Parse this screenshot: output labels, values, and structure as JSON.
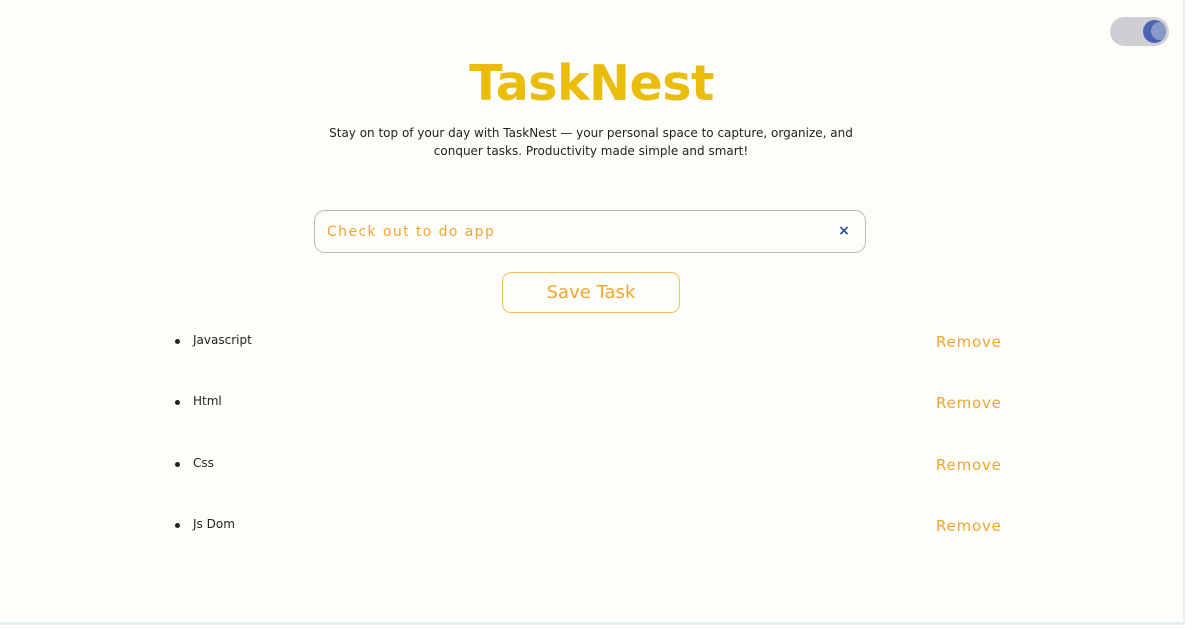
{
  "app": {
    "title": "TaskNest",
    "subtitle": "Stay on top of your day with TaskNest — your personal space to capture, organize, and conquer tasks. Productivity made simple and smart!",
    "accent_color": "#eabd0b",
    "action_color": "#f2a531"
  },
  "theme_toggle": {
    "state": "dark",
    "icon": "moon-icon"
  },
  "task_input": {
    "value": "Check out to do app",
    "clear_icon": "close-icon",
    "clear_label": "×"
  },
  "save_button": {
    "label": "Save Task"
  },
  "tasks": [
    {
      "text": "Javascript",
      "remove_label": "Remove"
    },
    {
      "text": "Html",
      "remove_label": "Remove"
    },
    {
      "text": "Css",
      "remove_label": "Remove"
    },
    {
      "text": "Js Dom",
      "remove_label": "Remove"
    }
  ]
}
